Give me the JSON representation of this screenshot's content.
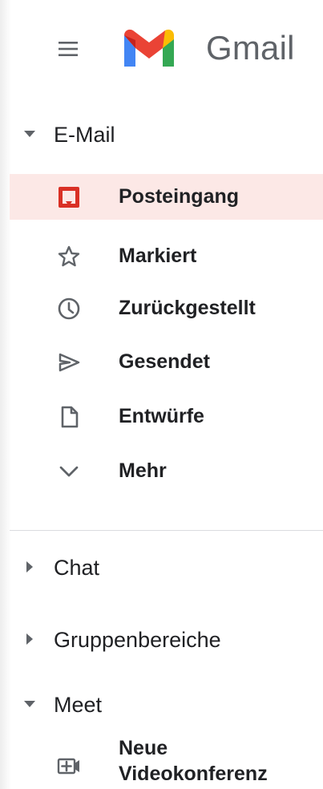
{
  "header": {
    "app_name": "Gmail",
    "menu_icon": "hamburger-icon",
    "logo": "gmail-logo"
  },
  "mail": {
    "title": "E-Mail",
    "items": [
      {
        "label": "Posteingang",
        "icon": "inbox-icon",
        "active": true
      },
      {
        "label": "Markiert",
        "icon": "star-icon",
        "active": false
      },
      {
        "label": "Zurückgestellt",
        "icon": "clock-icon",
        "active": false
      },
      {
        "label": "Gesendet",
        "icon": "send-icon",
        "active": false
      },
      {
        "label": "Entwürfe",
        "icon": "draft-icon",
        "active": false
      },
      {
        "label": "Mehr",
        "icon": "chevron-down-icon",
        "active": false
      }
    ]
  },
  "chat": {
    "title": "Chat"
  },
  "spaces": {
    "title": "Gruppenbereiche"
  },
  "meet": {
    "title": "Meet",
    "items": [
      {
        "label_line_1": "Neue",
        "label_line_2": "Videokonferenz",
        "icon": "new-meeting-icon"
      }
    ]
  },
  "colors": {
    "active_background": "#fce8e6",
    "active_icon": "#d93025",
    "text": "#202124",
    "secondary_text": "#5f6368",
    "divider": "#dadce0"
  }
}
